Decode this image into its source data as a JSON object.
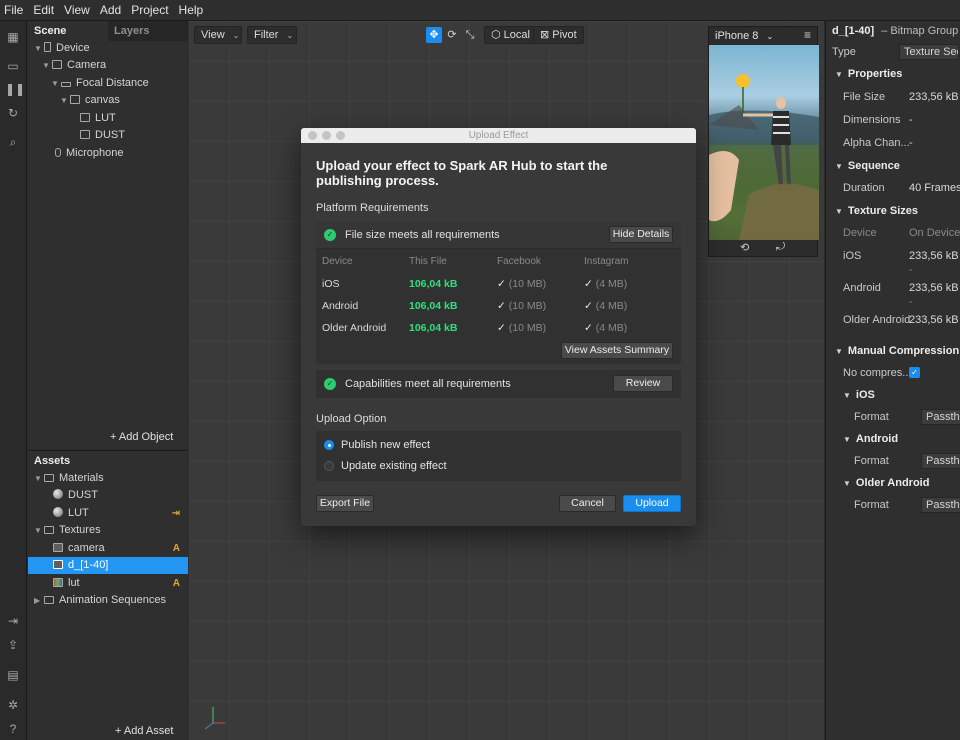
{
  "menu": [
    "File",
    "Edit",
    "View",
    "Add",
    "Project",
    "Help"
  ],
  "scene": {
    "tabs": [
      "Scene",
      "Layers"
    ],
    "tree": [
      {
        "label": "Device",
        "icon": "phone-icon"
      },
      {
        "label": "Camera",
        "icon": "camera-icon"
      },
      {
        "label": "Focal Distance",
        "icon": "focal-distance-icon"
      },
      {
        "label": "canvas",
        "icon": "canvas-icon"
      },
      {
        "label": "LUT",
        "icon": "rectangle-icon"
      },
      {
        "label": "DUST",
        "icon": "rectangle-icon"
      },
      {
        "label": "Microphone",
        "icon": "microphone-icon"
      }
    ],
    "add_object": "Add Object"
  },
  "assets": {
    "title": "Assets",
    "items": [
      {
        "label": "Materials"
      },
      {
        "label": "DUST"
      },
      {
        "label": "LUT",
        "badge": "⇥"
      },
      {
        "label": "Textures"
      },
      {
        "label": "camera",
        "badge": "A"
      },
      {
        "label": "d_[1-40]"
      },
      {
        "label": "lut",
        "badge": "A"
      },
      {
        "label": "Animation Sequences"
      }
    ],
    "add_asset": "Add Asset"
  },
  "viewport": {
    "view_label": "View",
    "filter_label": "Filter",
    "local_label": "Local",
    "pivot_label": "Pivot",
    "device_label": "iPhone 8"
  },
  "properties": {
    "name": "d_[1-40]",
    "kind": "– Bitmap Group",
    "type_label": "Type",
    "type_value": "Texture Sequ",
    "sections": {
      "properties": "Properties",
      "sequence": "Sequence",
      "texture_sizes": "Texture Sizes",
      "manual_compression": "Manual Compression",
      "ios": "iOS",
      "android": "Android",
      "older_android": "Older Android"
    },
    "file_size_label": "File Size",
    "file_size_value": "233,56 kB",
    "dimensions_label": "Dimensions",
    "dimensions_value": "-",
    "alpha_label": "Alpha Chan...",
    "alpha_value": "-",
    "duration_label": "Duration",
    "duration_value": "40 Frames",
    "device_col": "Device",
    "ondevice_col": "On Device",
    "sizes": [
      {
        "device": "iOS",
        "value": "233,56 kB",
        "sub": "-"
      },
      {
        "device": "Android",
        "value": "233,56 kB",
        "sub": "-"
      },
      {
        "device": "Older Android",
        "value": "233,56 kB"
      }
    ],
    "no_compression_label": "No compres...",
    "format_label": "Format",
    "format_value": "Passthro"
  },
  "modal": {
    "window_title": "Upload Effect",
    "heading": "Upload your effect to Spark AR Hub to start the publishing process.",
    "platform_requirements": "Platform Requirements",
    "file_size_ok": "File size meets all requirements",
    "hide_details": "Hide Details",
    "columns": [
      "Device",
      "This File",
      "Facebook",
      "Instagram"
    ],
    "rows": [
      {
        "device": "iOS",
        "size": "106,04 kB",
        "fb": "(10 MB)",
        "ig": "(4 MB)"
      },
      {
        "device": "Android",
        "size": "106,04 kB",
        "fb": "(10 MB)",
        "ig": "(4 MB)"
      },
      {
        "device": "Older Android",
        "size": "106,04 kB",
        "fb": "(10 MB)",
        "ig": "(4 MB)"
      }
    ],
    "check_glyph": "✓",
    "view_assets_summary": "View Assets Summary",
    "capabilities_ok": "Capabilities meet all requirements",
    "review": "Review",
    "upload_option": "Upload Option",
    "publish_new": "Publish new effect",
    "update_existing": "Update existing effect",
    "export_file": "Export File",
    "cancel": "Cancel",
    "upload": "Upload"
  }
}
